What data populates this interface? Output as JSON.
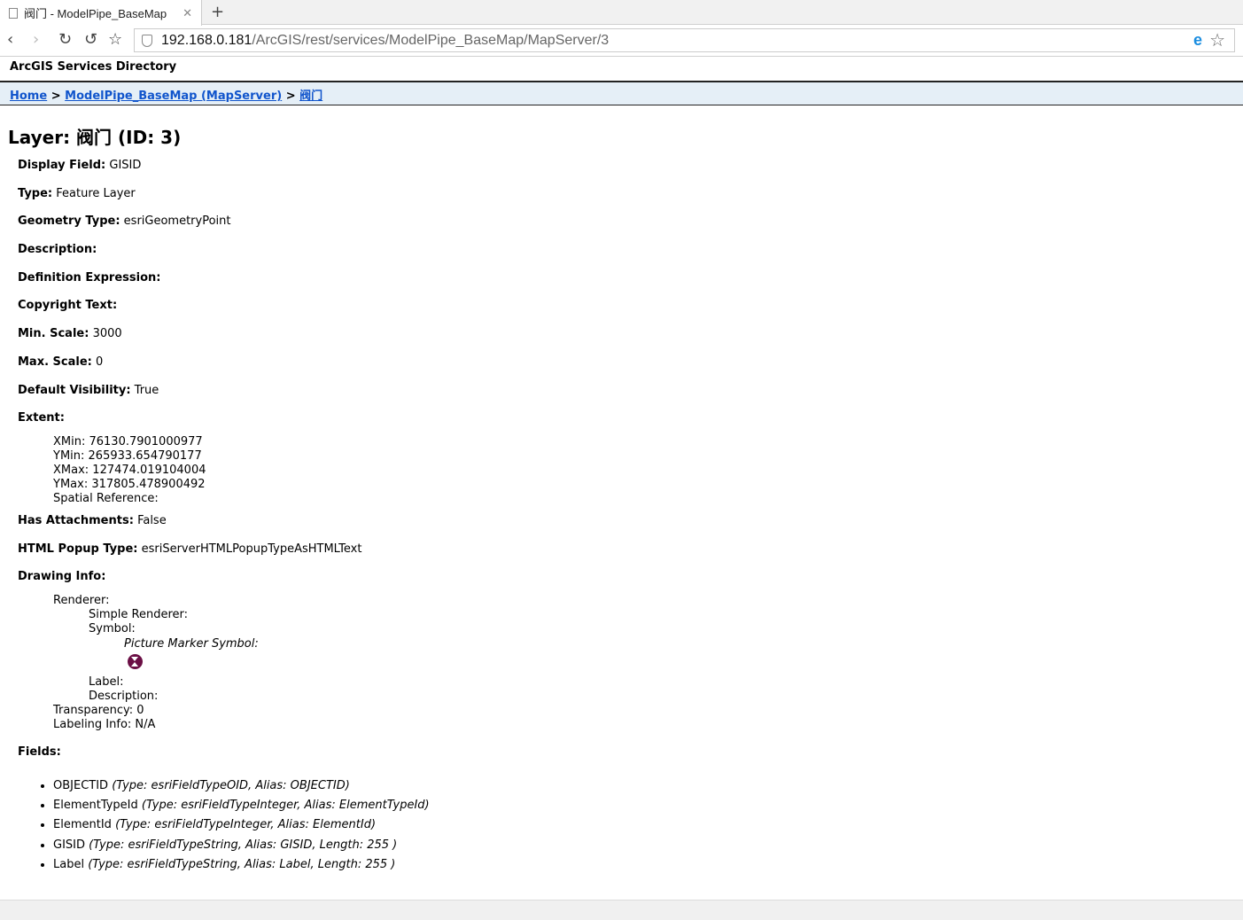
{
  "browser": {
    "tab_title": "阀门 - ModelPipe_BaseMap",
    "url_host": "192.168.0.181",
    "url_path": "/ArcGIS/rest/services/ModelPipe_BaseMap/MapServer/3"
  },
  "header": "ArcGIS Services Directory",
  "breadcrumb": {
    "home": "Home",
    "sep": ">",
    "service": "ModelPipe_BaseMap (MapServer)",
    "layer": "阀门"
  },
  "title": "Layer: 阀门 (ID: 3)",
  "props": [
    {
      "label": "Display Field:",
      "value": "GISID"
    },
    {
      "label": "Type:",
      "value": "Feature Layer"
    },
    {
      "label": "Geometry Type:",
      "value": "esriGeometryPoint"
    },
    {
      "label": "Description:",
      "value": ""
    },
    {
      "label": "Definition Expression:",
      "value": ""
    },
    {
      "label": "Copyright Text:",
      "value": ""
    },
    {
      "label": "Min. Scale:",
      "value": "3000"
    },
    {
      "label": "Max. Scale:",
      "value": "0"
    },
    {
      "label": "Default Visibility:",
      "value": "True"
    },
    {
      "label": "Extent:",
      "value": ""
    }
  ],
  "extent": [
    "XMin: 76130.7901000977",
    "YMin: 265933.654790177",
    "XMax: 127474.019104004",
    "YMax: 317805.478900492",
    "Spatial Reference:"
  ],
  "props2": [
    {
      "label": "Has Attachments:",
      "value": "False"
    },
    {
      "label": "HTML Popup Type:",
      "value": "esriServerHTMLPopupTypeAsHTMLText"
    },
    {
      "label": "Drawing Info:",
      "value": ""
    }
  ],
  "drawing": {
    "renderer": "Renderer:",
    "simple": "Simple Renderer:",
    "symbol": "Symbol:",
    "pms": "Picture Marker Symbol:",
    "label": "Label:",
    "description": "Description:",
    "transparency": "Transparency: 0",
    "labeling": "Labeling Info: N/A"
  },
  "fields_label": "Fields:",
  "fields": [
    {
      "name": "OBJECTID",
      "info": "(Type: esriFieldTypeOID, Alias: OBJECTID)"
    },
    {
      "name": "ElementTypeId",
      "info": "(Type: esriFieldTypeInteger, Alias: ElementTypeId)"
    },
    {
      "name": "ElementId",
      "info": "(Type: esriFieldTypeInteger, Alias: ElementId)"
    },
    {
      "name": "GISID",
      "info": "(Type: esriFieldTypeString, Alias: GISID, Length: 255 )"
    },
    {
      "name": "Label",
      "info": "(Type: esriFieldTypeString, Alias: Label, Length: 255 )"
    }
  ]
}
